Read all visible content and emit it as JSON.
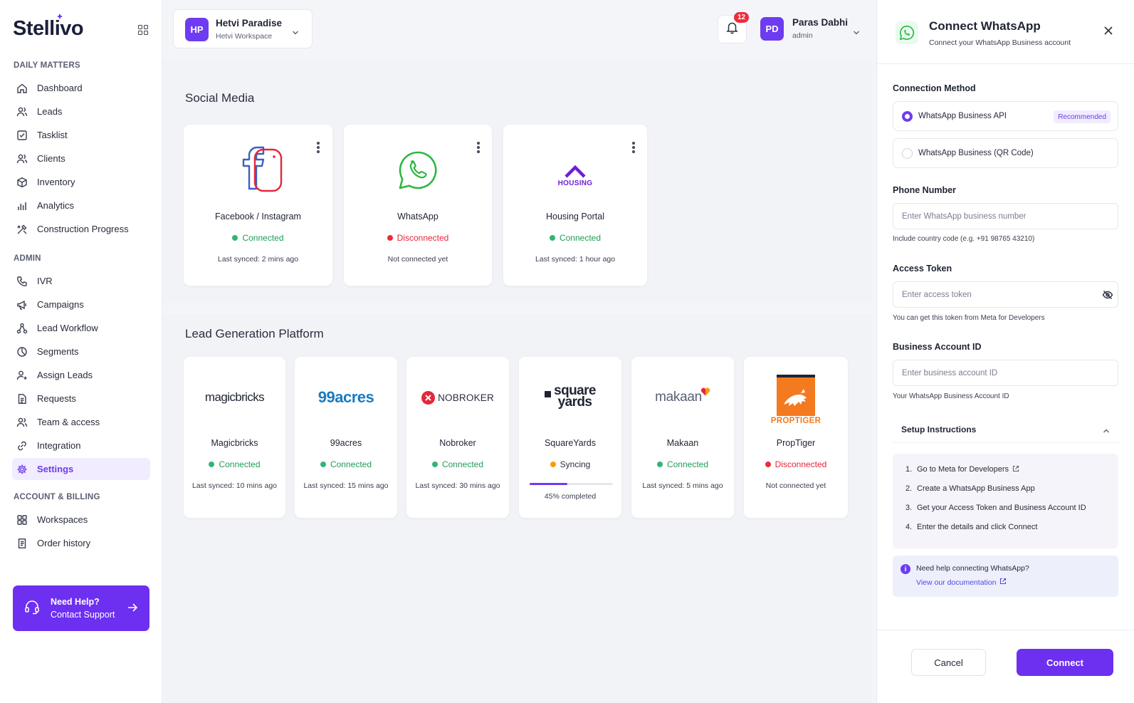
{
  "app": {
    "name": "Stellivo"
  },
  "colors": {
    "accent": "#6d3cf0",
    "connected": "#2fb772",
    "disconnected": "#ef2b3a",
    "syncing": "#f59e0b"
  },
  "sidebar": {
    "sections": [
      {
        "label": "DAILY MATTERS"
      },
      {
        "label": "ADMIN"
      },
      {
        "label": "ACCOUNT & BILLING"
      }
    ],
    "items": [
      {
        "label": "Dashboard",
        "icon": "home-icon"
      },
      {
        "label": "Leads",
        "icon": "users-icon"
      },
      {
        "label": "Tasklist",
        "icon": "checkbox-icon"
      },
      {
        "label": "Clients",
        "icon": "users-icon"
      },
      {
        "label": "Inventory",
        "icon": "box-icon"
      },
      {
        "label": "Analytics",
        "icon": "bar-chart-icon"
      },
      {
        "label": "Construction Progress",
        "icon": "tools-icon"
      },
      {
        "label": "IVR",
        "icon": "phone-icon"
      },
      {
        "label": "Campaigns",
        "icon": "megaphone-icon"
      },
      {
        "label": "Lead Workflow",
        "icon": "workflow-icon"
      },
      {
        "label": "Segments",
        "icon": "pie-icon"
      },
      {
        "label": "Assign Leads",
        "icon": "user-plus-icon"
      },
      {
        "label": "Requests",
        "icon": "document-icon"
      },
      {
        "label": "Team & access",
        "icon": "team-icon"
      },
      {
        "label": "Integration",
        "icon": "link-icon"
      },
      {
        "label": "Settings",
        "icon": "gear-icon"
      },
      {
        "label": "Workspaces",
        "icon": "grid-icon"
      },
      {
        "label": "Order history",
        "icon": "receipt-icon"
      }
    ],
    "help": {
      "title": "Need Help?",
      "subtitle": "Contact Support"
    }
  },
  "header": {
    "workspace": {
      "initials": "HP",
      "name": "Hetvi Paradise",
      "sub": "Hetvi Workspace"
    },
    "notifications": {
      "count": "12"
    },
    "user": {
      "initials": "PD",
      "name": "Paras Dabhi",
      "role": "admin"
    }
  },
  "social": {
    "title": "Social Media",
    "cards": [
      {
        "name": "Facebook / Instagram",
        "status": "Connected",
        "sync": "Last synced: 2 mins ago"
      },
      {
        "name": "WhatsApp",
        "status": "Disconnected",
        "sync": "Not connected yet"
      },
      {
        "name": "Housing Portal",
        "status": "Connected",
        "sync": "Last synced: 1 hour ago",
        "logo_text": "HOUSING"
      }
    ]
  },
  "leadgen": {
    "title": "Lead Generation Platform",
    "cards": [
      {
        "name": "Magicbricks",
        "status": "Connected",
        "sync": "Last synced: 10 mins ago",
        "logo_text": "magicbricks"
      },
      {
        "name": "99acres",
        "status": "Connected",
        "sync": "Last synced: 15 mins ago",
        "logo_text": "99acres"
      },
      {
        "name": "Nobroker",
        "status": "Connected",
        "sync": "Last synced: 30 mins ago",
        "logo_text": "NOBROKER"
      },
      {
        "name": "SquareYards",
        "status": "Syncing",
        "sync": "45% completed",
        "progress": 0.45,
        "logo_line1": "square",
        "logo_line2": "yards"
      },
      {
        "name": "Makaan",
        "status": "Connected",
        "sync": "Last synced: 5 mins ago",
        "logo_text": "makaan"
      },
      {
        "name": "PropTiger",
        "status": "Disconnected",
        "sync": "Not connected yet",
        "logo_text": "PROPTIGER"
      }
    ]
  },
  "drawer": {
    "title": "Connect WhatsApp",
    "subtitle": "Connect your WhatsApp Business account",
    "method_label": "Connection Method",
    "methods": [
      {
        "label": "WhatsApp Business API",
        "badge": "Recommended",
        "selected": true
      },
      {
        "label": "WhatsApp Business (QR Code)",
        "selected": false
      }
    ],
    "phone": {
      "label": "Phone Number",
      "placeholder": "Enter WhatsApp business number",
      "value": "",
      "hint": "Include country code (e.g. +91 98765 43210)"
    },
    "token": {
      "label": "Access Token",
      "placeholder": "Enter access token",
      "value": "",
      "hint": "You can get this token from Meta for Developers"
    },
    "account": {
      "label": "Business Account ID",
      "placeholder": "Enter business account ID",
      "value": "",
      "hint": "Your WhatsApp Business Account ID"
    },
    "setup": {
      "title": "Setup Instructions",
      "steps": [
        {
          "n": "1.",
          "text": "Go to Meta for Developers"
        },
        {
          "n": "2.",
          "text": "Create a WhatsApp Business App"
        },
        {
          "n": "3.",
          "text": "Get your Access Token and Business Account ID"
        },
        {
          "n": "4.",
          "text": "Enter the details and click Connect"
        }
      ]
    },
    "help": {
      "question": "Need help connecting WhatsApp?",
      "link": "View our documentation"
    },
    "cancel_label": "Cancel",
    "connect_label": "Connect"
  }
}
